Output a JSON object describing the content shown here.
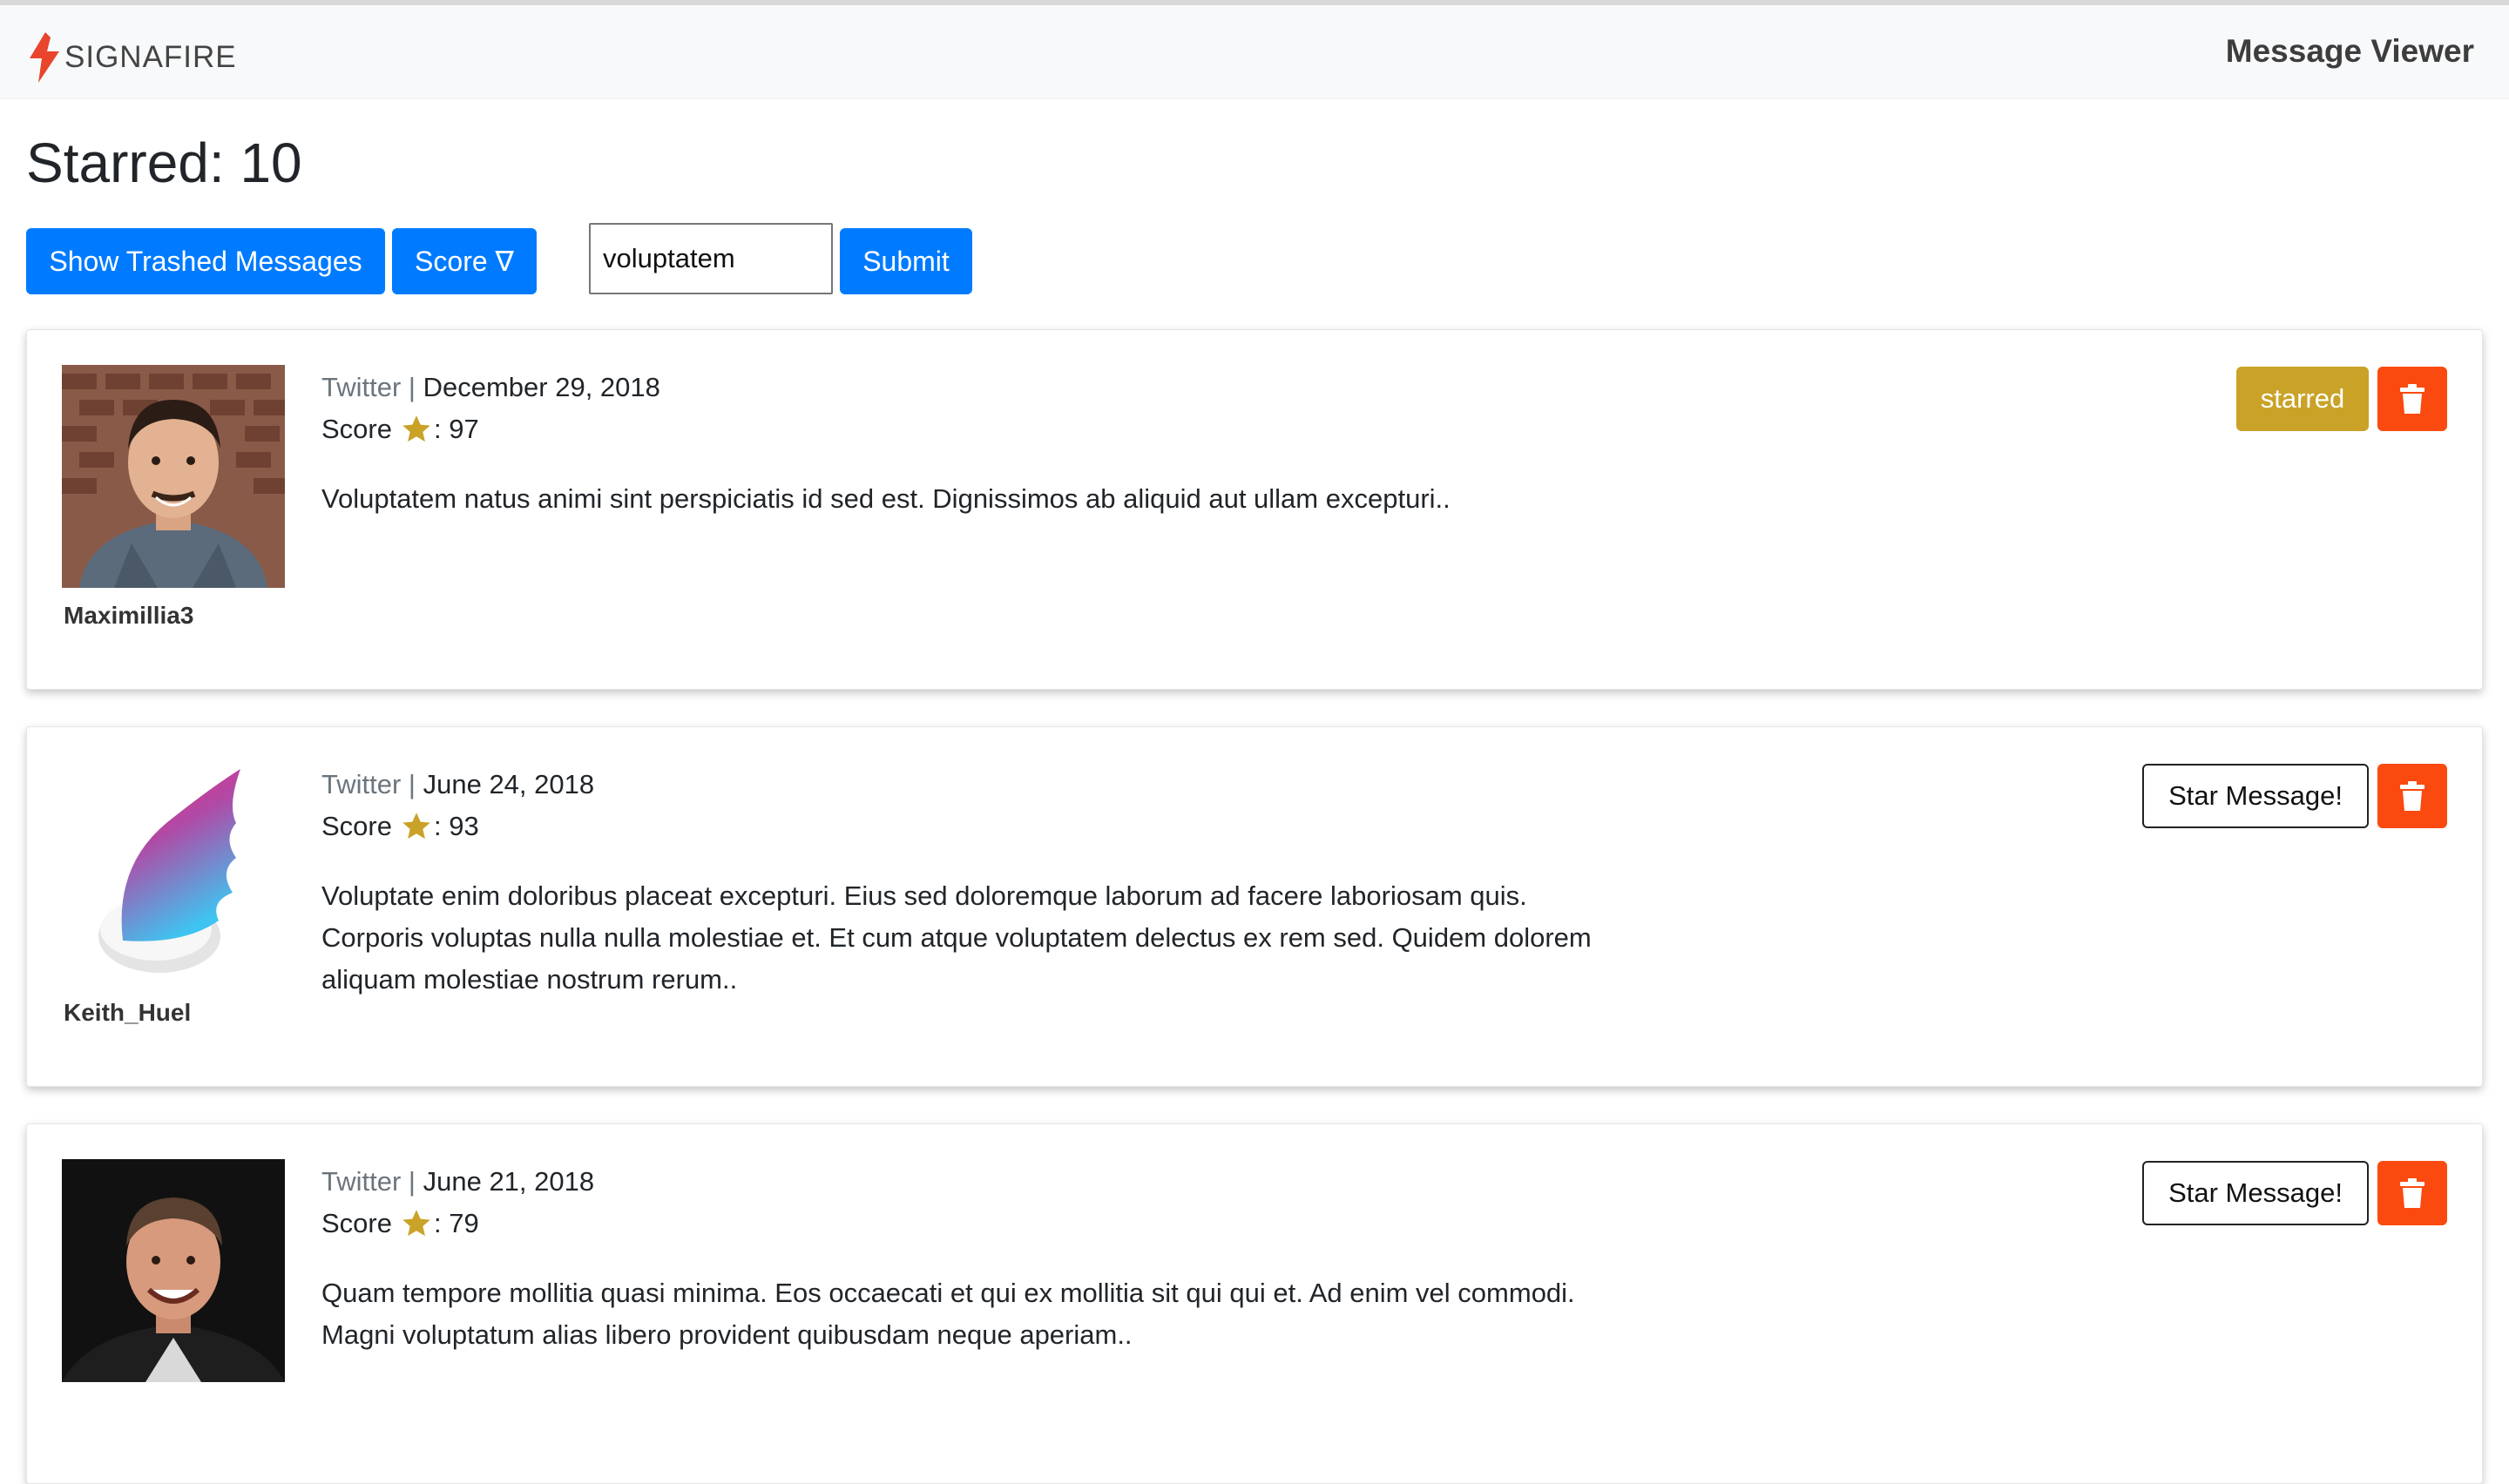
{
  "app": {
    "brand": "SIGNAFIRE",
    "page_title": "Message Viewer"
  },
  "heading": "Starred: 10",
  "toolbar": {
    "show_trashed_label": "Show Trashed Messages",
    "sort_label": "Score ∇",
    "search_value": "voluptatem",
    "submit_label": "Submit"
  },
  "messages": [
    {
      "username": "Maximillia3",
      "source": "Twitter",
      "separator": "|",
      "date": "December 29, 2018",
      "score_label": "Score",
      "score": ": 97",
      "text": "Voluptatem natus animi sint perspiciatis id sed est. Dignissimos ab aliquid aut ullam excepturi..",
      "action_label": "starred",
      "starred": true
    },
    {
      "username": "Keith_Huel",
      "source": "Twitter",
      "separator": "|",
      "date": "June 24, 2018",
      "score_label": "Score",
      "score": ": 93",
      "text": "Voluptate enim doloribus placeat excepturi. Eius sed doloremque laborum ad facere laboriosam quis. Corporis voluptas nulla nulla molestiae et. Et cum atque voluptatem delectus ex rem sed. Quidem dolorem aliquam molestiae nostrum rerum..",
      "action_label": "Star Message!",
      "starred": false
    },
    {
      "username": "",
      "source": "Twitter",
      "separator": "|",
      "date": "June 21, 2018",
      "score_label": "Score",
      "score": ": 79",
      "text": "Quam tempore mollitia quasi minima. Eos occaecati et qui ex mollitia sit qui qui et. Ad enim vel commodi. Magni voluptatum alias libero provident quibusdam neque aperiam..",
      "action_label": "Star Message!",
      "starred": false
    }
  ],
  "icons": {
    "star": "star-icon",
    "trash": "trash-icon",
    "logo": "flame-logo-icon"
  },
  "colors": {
    "primary": "#007bff",
    "starred": "#c9a227",
    "danger": "#fa4a10",
    "star_icon": "#c9a227"
  }
}
